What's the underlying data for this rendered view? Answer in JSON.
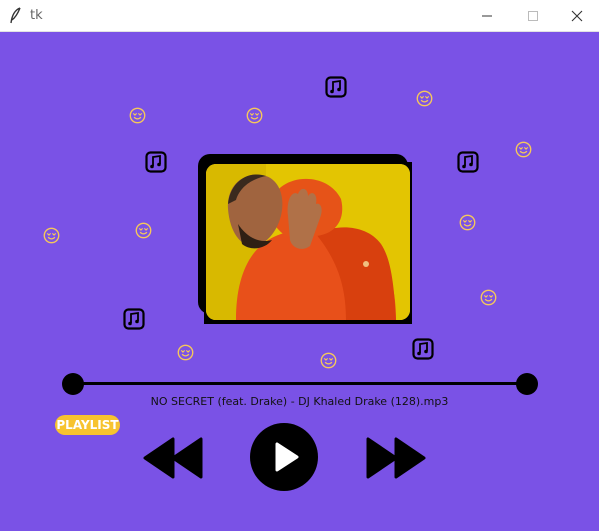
{
  "window": {
    "title": "tk",
    "icon": "feather-icon",
    "controls": [
      "minimize-icon",
      "maximize-icon",
      "close-icon"
    ]
  },
  "colors": {
    "background": "#7a52e6",
    "titlebar": "#ffffff",
    "playlist_button": "#f7c32f",
    "emoji": "#f6c85a",
    "controls": "#000000"
  },
  "decorations": {
    "emoji_icon": "heart-eyes-emoji-icon",
    "note_icon": "music-note-icon"
  },
  "player": {
    "album_art": "album-art-image",
    "song_title": "NO SECRET (feat. Drake) - DJ Khaled  Drake (128).mp3",
    "playlist_label": "PLAYLIST",
    "progress": 0
  },
  "controls": {
    "rewind": "rewind-icon",
    "play": "play-icon",
    "forward": "fast-forward-icon"
  }
}
